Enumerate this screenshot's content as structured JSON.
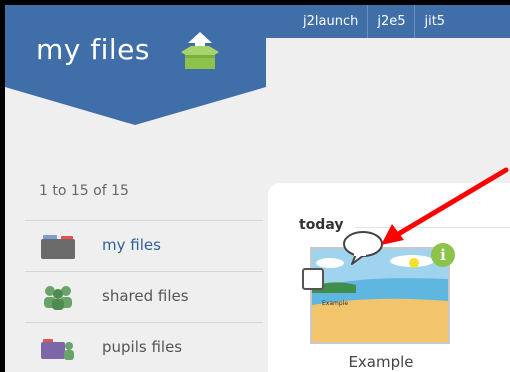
{
  "topnav": {
    "links": [
      "j2launch",
      "j2e5",
      "jit5"
    ]
  },
  "banner": {
    "title": "my files",
    "icon": "box-upload-icon",
    "color": "#3f6ea8",
    "icon_color": "#8cc34a"
  },
  "sidebar": {
    "count": "1 to 15 of 15",
    "items": [
      {
        "label": "my files",
        "icon": "folder-icon",
        "active": true
      },
      {
        "label": "shared files",
        "icon": "people-icon",
        "active": false
      },
      {
        "label": "pupils files",
        "icon": "pupil-folder-icon",
        "active": false
      }
    ]
  },
  "main": {
    "section_heading": "today",
    "file": {
      "name": "Example",
      "thumbnail_text": "Example",
      "icon_info": "info-icon",
      "icon_comment": "speech-bubble-icon"
    }
  },
  "annotation": {
    "color": "#ff0000",
    "icon": "red-arrow"
  }
}
